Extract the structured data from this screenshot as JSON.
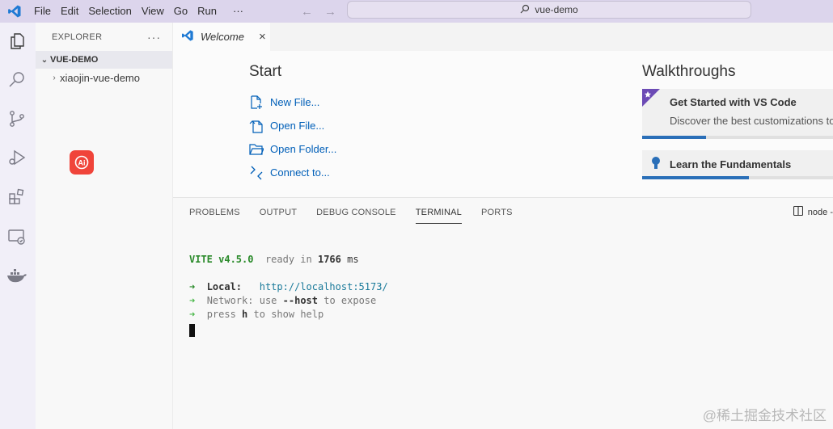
{
  "titlebar": {
    "menu": [
      "File",
      "Edit",
      "Selection",
      "View",
      "Go",
      "Run"
    ],
    "more": "···",
    "search_text": "vue-demo"
  },
  "explorer": {
    "header": "EXPLORER",
    "more": "···",
    "folder": "VUE-DEMO",
    "items": [
      {
        "label": "xiaojin-vue-demo"
      }
    ]
  },
  "editor": {
    "tab_label": "Welcome",
    "tab_close": "×",
    "start": {
      "title": "Start",
      "items": [
        {
          "label": "New File..."
        },
        {
          "label": "Open File..."
        },
        {
          "label": "Open Folder..."
        },
        {
          "label": "Connect to..."
        }
      ]
    },
    "walkthroughs": {
      "title": "Walkthroughs",
      "cards": [
        {
          "title": "Get Started with VS Code",
          "desc": "Discover the best customizations to",
          "progress": 0.33
        },
        {
          "title": "Learn the Fundamentals",
          "progress": 0.55
        }
      ]
    }
  },
  "panel": {
    "tabs": [
      "PROBLEMS",
      "OUTPUT",
      "DEBUG CONSOLE",
      "TERMINAL",
      "PORTS"
    ],
    "active_tab": "TERMINAL",
    "terminal_name": "node -",
    "terminal": {
      "vite": "VITE v4.5.0",
      "ready": "ready in",
      "ms_value": "1766",
      "ms_unit": "ms",
      "local_label": "Local:",
      "local_url": "http://localhost:5173/",
      "network_label": "Network:",
      "network_text1": "use",
      "network_flag": "--host",
      "network_text2": "to expose",
      "press1": "press",
      "press_key": "h",
      "press2": "to show help",
      "arrow": "➜"
    }
  },
  "watermark": "@稀土掘金技术社区"
}
